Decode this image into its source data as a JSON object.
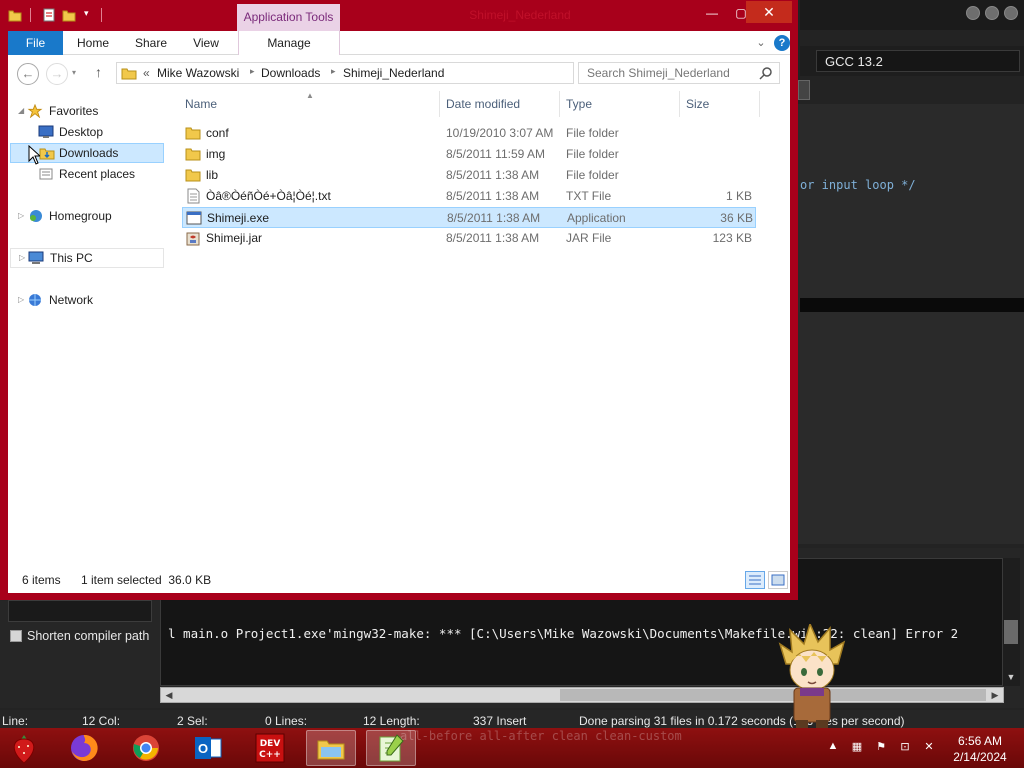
{
  "explorer": {
    "title": "Shimeji_Nederland",
    "contextual_tab_group": "Application Tools",
    "ribbon_tabs": [
      {
        "label": "File"
      },
      {
        "label": "Home"
      },
      {
        "label": "Share"
      },
      {
        "label": "View"
      },
      {
        "label": "Manage"
      }
    ],
    "address": {
      "overflow": "«",
      "segments": [
        "Mike Wazowski",
        "Downloads",
        "Shimeji_Nederland"
      ]
    },
    "search": {
      "placeholder": "Search Shimeji_Nederland"
    },
    "nav": {
      "favorites": "Favorites",
      "desktop": "Desktop",
      "downloads": "Downloads",
      "recent": "Recent places",
      "homegroup": "Homegroup",
      "this_pc": "This PC",
      "network": "Network"
    },
    "columns": {
      "name": "Name",
      "date": "Date modified",
      "type": "Type",
      "size": "Size"
    },
    "files": [
      {
        "name": "conf",
        "date": "10/19/2010 3:07 AM",
        "type": "File folder",
        "size": "",
        "icon": "folder-icon"
      },
      {
        "name": "img",
        "date": "8/5/2011 11:59 AM",
        "type": "File folder",
        "size": "",
        "icon": "folder-icon"
      },
      {
        "name": "lib",
        "date": "8/5/2011 1:38 AM",
        "type": "File folder",
        "size": "",
        "icon": "folder-icon"
      },
      {
        "name": "Òâ®ÒéñÒé+Òâ¦Òé¦.txt",
        "date": "8/5/2011 1:38 AM",
        "type": "TXT File",
        "size": "1 KB",
        "icon": "text-file-icon"
      },
      {
        "name": "Shimeji.exe",
        "date": "8/5/2011 1:38 AM",
        "type": "Application",
        "size": "36 KB",
        "icon": "application-icon"
      },
      {
        "name": "Shimeji.jar",
        "date": "8/5/2011 1:38 AM",
        "type": "JAR File",
        "size": "123 KB",
        "icon": "jar-file-icon"
      }
    ],
    "selected_index": 4,
    "status": {
      "count": "6 items",
      "selection": "1 item selected  36.0 KB"
    }
  },
  "ide": {
    "compiler": "GCC 13.2",
    "editor_fragment": "or input loop */",
    "shorten_label": "Shorten compiler path",
    "log_line": "l main.o Project1.exe'mingw32-make: *** [C:\\Users\\Mike Wazowski\\Documents\\Makefile.win:22: clean] Error 2",
    "status": {
      "line": "Line:",
      "col": "12 Col:",
      "sel": "2 Sel:",
      "lines": "0 Lines:",
      "length": "12 Length:",
      "insert": "337 Insert",
      "parsing": "Done parsing 31 files in 0.172 seconds (183 files per second)"
    }
  },
  "taskbar": {
    "ghost_text": "all-before all-after clean clean-custom",
    "clock_time": "6:56 AM",
    "clock_date": "2/14/2024"
  }
}
